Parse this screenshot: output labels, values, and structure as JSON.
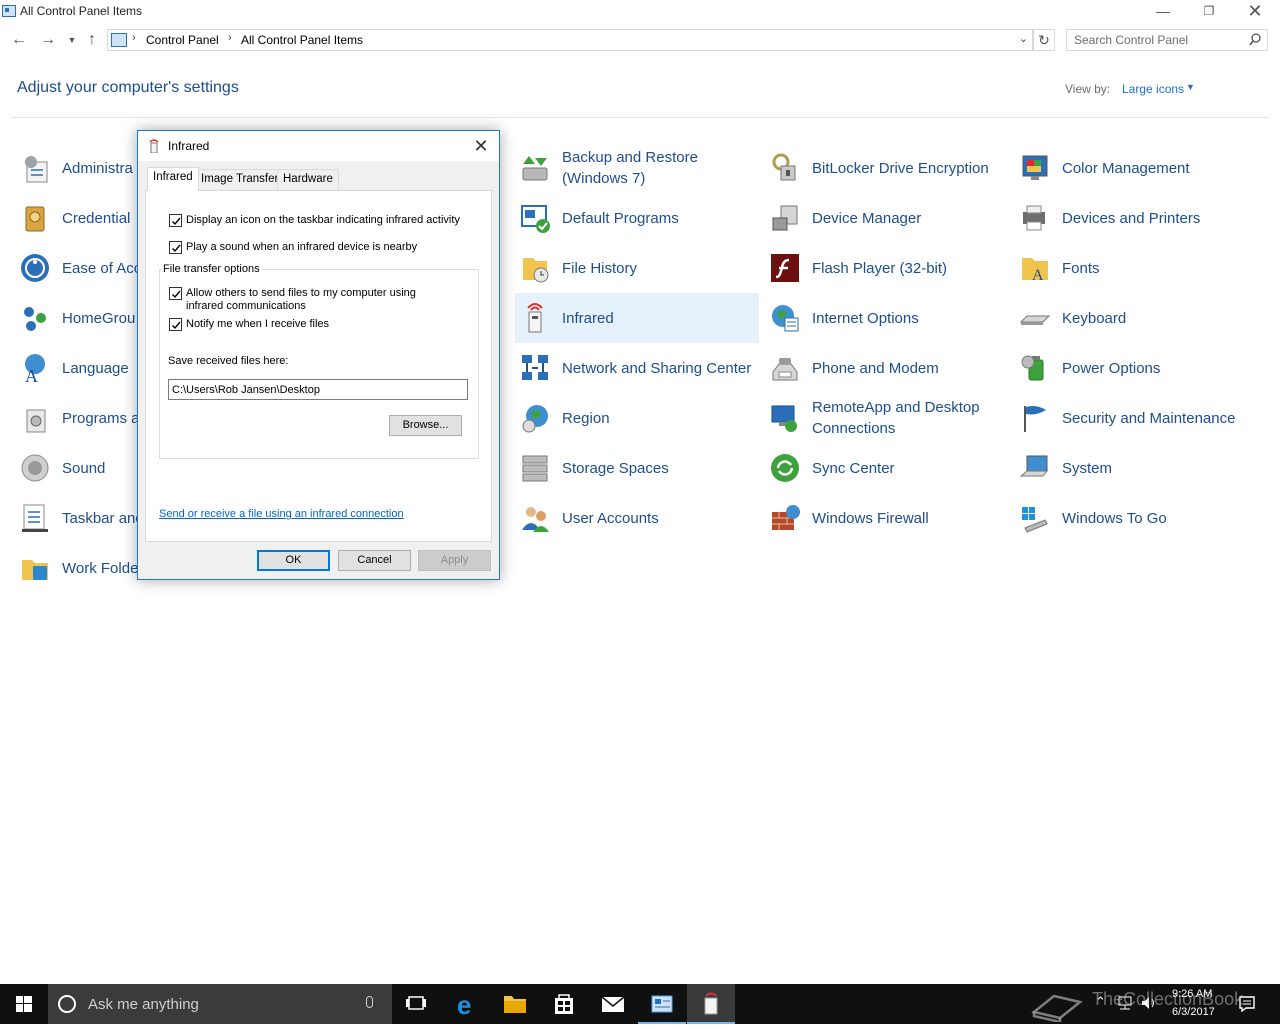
{
  "window": {
    "title": "All Control Panel Items"
  },
  "address_bar": {
    "crumbs": [
      "Control Panel",
      "All Control Panel Items"
    ]
  },
  "search": {
    "placeholder": "Search Control Panel"
  },
  "header": {
    "title": "Adjust your computer's settings",
    "view_by_label": "View by:",
    "view_by_value": "Large icons"
  },
  "items": {
    "col1": [
      "Administra",
      "Credential",
      "Ease of Acc",
      "HomeGrou",
      "Language",
      "Programs a",
      "Sound",
      "Taskbar and",
      "Work Folde"
    ],
    "col3": [
      "Backup and Restore (Windows 7)",
      "Default Programs",
      "File History",
      "Infrared",
      "Network and Sharing Center",
      "Region",
      "Storage Spaces",
      "User Accounts"
    ],
    "col4": [
      "BitLocker Drive Encryption",
      "Device Manager",
      "Flash Player (32-bit)",
      "Internet Options",
      "Phone and Modem",
      "RemoteApp and Desktop Connections",
      "Sync Center",
      "Windows Firewall"
    ],
    "col5": [
      "Color Management",
      "Devices and Printers",
      "Fonts",
      "Keyboard",
      "Power Options",
      "Security and Maintenance",
      "System",
      "Windows To Go"
    ],
    "selected": "Infrared"
  },
  "dialog": {
    "title": "Infrared",
    "tabs": [
      "Infrared",
      "Image Transfer",
      "Hardware"
    ],
    "active_tab": "Infrared",
    "checkboxes": {
      "taskbar_icon": {
        "label": "Display an icon on the taskbar indicating infrared activity",
        "checked": true
      },
      "play_sound": {
        "label": "Play a sound when an infrared device is nearby",
        "checked": true
      },
      "allow_send": {
        "label": "Allow others to send files to my computer using infrared communications",
        "checked": true
      },
      "notify": {
        "label": "Notify me when I receive files",
        "checked": true
      }
    },
    "group_title": "File transfer options",
    "save_label": "Save received files here:",
    "save_path": "C:\\Users\\Rob Jansen\\Desktop",
    "browse": "Browse...",
    "link": "Send or receive a file using an infrared connection",
    "ok": "OK",
    "cancel": "Cancel",
    "apply": "Apply"
  },
  "taskbar": {
    "search_text": "Ask me anything",
    "time": "9:26 AM",
    "date": "6/3/2017",
    "watermark": "TheCollectionBook",
    "apps": [
      "task-view",
      "edge",
      "file-explorer",
      "store",
      "mail",
      "control-panel",
      "infrared"
    ]
  },
  "colors": {
    "link": "#1e4e8c",
    "selected_bg": "#e5f1fb",
    "accent": "#0078d7",
    "taskbar": "#101010"
  }
}
